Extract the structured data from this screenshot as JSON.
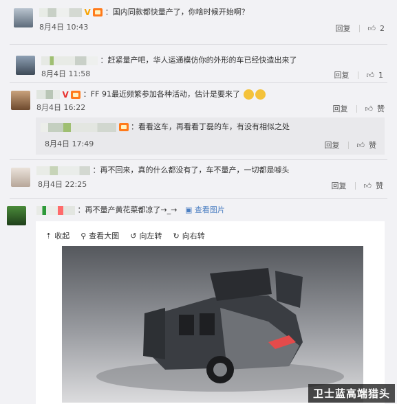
{
  "comments": [
    {
      "text": "：国内同款都快量产了，你啥时候开始啊？",
      "time": "8月4日 10:43",
      "reply_label": "回复",
      "like_count": "2"
    },
    {
      "text": "：赶紧量产吧，华人运通模仿你的外形的车已经快造出来了",
      "time": "8月4日 11:58",
      "reply_label": "回复",
      "like_count": "1"
    },
    {
      "text": "：FF 91最近频繁参加各种活动，估计是要来了",
      "time": "8月4日 16:22",
      "reply_label": "回复",
      "like_label": "赞"
    },
    {
      "text": "：看看这车，再看看丁磊的车，有没有相似之处",
      "time": "8月4日 17:49",
      "reply_label": "回复",
      "like_label": "赞"
    },
    {
      "text": "：再不回来，真的什么都没有了，车不量产，一切都是噱头",
      "time": "8月4日 22:25",
      "reply_label": "回复",
      "like_label": "赞"
    },
    {
      "text": "：再不量产黄花菜都凉了→_→",
      "view_image": "查看图片"
    }
  ],
  "image_toolbar": {
    "collapse": "收起",
    "view_large": "查看大图",
    "rotate_left": "向左转",
    "rotate_right": "向右转"
  },
  "watermark": "卫士蓝高端猎头",
  "colors": {
    "link": "#4c7fc2",
    "vip_badge": "#f7a300",
    "level_badge": "#ff7a1a"
  }
}
